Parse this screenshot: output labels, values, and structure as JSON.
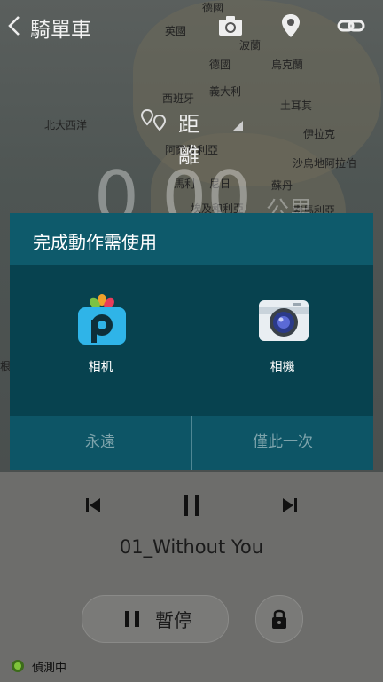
{
  "header": {
    "title": "騎單車",
    "icons": [
      "back-icon",
      "camera-icon",
      "location-pin-icon",
      "link-icon"
    ]
  },
  "map": {
    "labels": [
      "德國",
      "英國",
      "波蘭",
      "德國",
      "烏克蘭",
      "義大利",
      "西班牙",
      "土耳其",
      "北大西洋",
      "伊拉克",
      "阿爾及利亞",
      "沙烏地阿拉伯",
      "馬利",
      "尼日",
      "蘇丹",
      "埃及和利亞",
      "索馬利亞",
      "根"
    ]
  },
  "workout": {
    "distance_label": "距離",
    "distance_value": "0.00",
    "distance_unit": "公里"
  },
  "dialog": {
    "title": "完成動作需使用",
    "apps": [
      {
        "label": "相机",
        "icon": "picsart-app-icon"
      },
      {
        "label": "相機",
        "icon": "camera-app-icon"
      }
    ],
    "always_label": "永遠",
    "once_label": "僅此一次"
  },
  "player": {
    "track_title": "01_Without You",
    "pause_label": "暫停",
    "status_text": "偵測中"
  },
  "colors": {
    "dialog_header": "#0e5a6b",
    "dialog_body": "#07424f",
    "status_green": "#5a8f2a"
  }
}
